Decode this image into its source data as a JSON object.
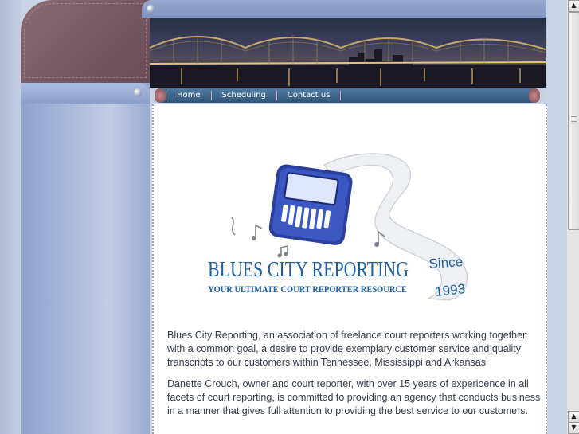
{
  "nav": {
    "items": [
      {
        "label": "Home"
      },
      {
        "label": "Scheduling"
      },
      {
        "label": "Contact us"
      }
    ]
  },
  "logo": {
    "name": "BLUES CITY REPORTING",
    "tagline": "YOUR ULTIMATE COURT REPORTER RESOURCE",
    "since_label": "Since",
    "since_year": "1993"
  },
  "content": {
    "paragraph_1": "Blues City Reporting, an association of freelance court reporters working together with a common goal, a desire to provide exemplary customer service and quality transcripts to our customers within Tennessee, Mississippi and Arkansas",
    "paragraph_2": "Danette Crouch, owner and court reporter, with over 15 years of experioence in all facets of court reporting, is committed to providing an agency that conducts business in a manner that gives full attention to providing the best service to our customers."
  },
  "colors": {
    "nav_bar": "#3a6389",
    "logo_blue": "#1f5fa6",
    "text": "#333a4a",
    "maroon": "#765660"
  },
  "icons": {
    "scroll_up": "▲",
    "scroll_down": "▼"
  }
}
